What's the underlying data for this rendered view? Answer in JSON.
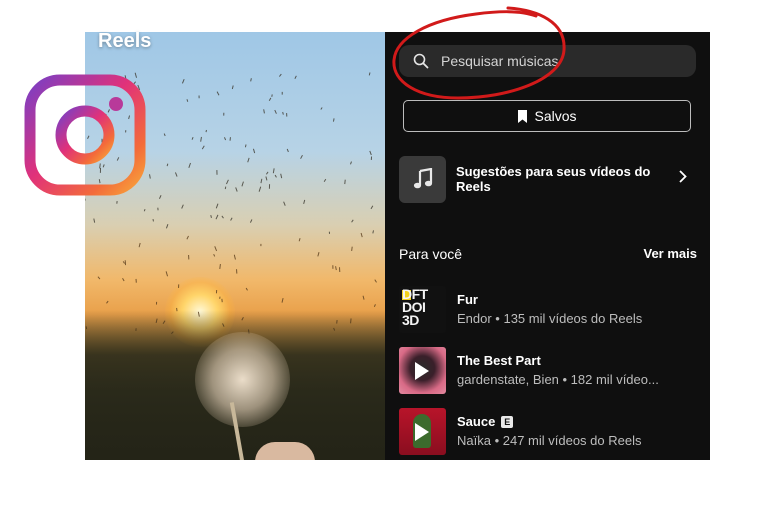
{
  "reels_label": "Reels",
  "search": {
    "placeholder": "Pesquisar músicas"
  },
  "saved_button": {
    "label": "Salvos"
  },
  "suggestions": {
    "label": "Sugestões para seus vídeos do Reels"
  },
  "section": {
    "title": "Para você",
    "see_more": "Ver mais"
  },
  "tracks": [
    {
      "title": "Fur",
      "meta": "Endor • 135 mil vídeos do Reels",
      "cover_text": "DFT\nDOI\n3D",
      "explicit": ""
    },
    {
      "title": "The Best Part",
      "meta": "gardenstate, Bien • 182 mil vídeo...",
      "explicit": ""
    },
    {
      "title": "Sauce",
      "meta": "Naïka • 247 mil vídeos do Reels",
      "explicit": "E"
    }
  ],
  "icons": {
    "logo": "instagram-logo",
    "search": "search-icon",
    "bookmark": "bookmark-icon",
    "music": "music-note-icon",
    "chevron": "chevron-right-icon",
    "play": "play-icon"
  },
  "colors": {
    "panel_bg": "#0f0f0f",
    "search_bg": "#2a2a2a",
    "annotation_red": "#d11a1a"
  }
}
